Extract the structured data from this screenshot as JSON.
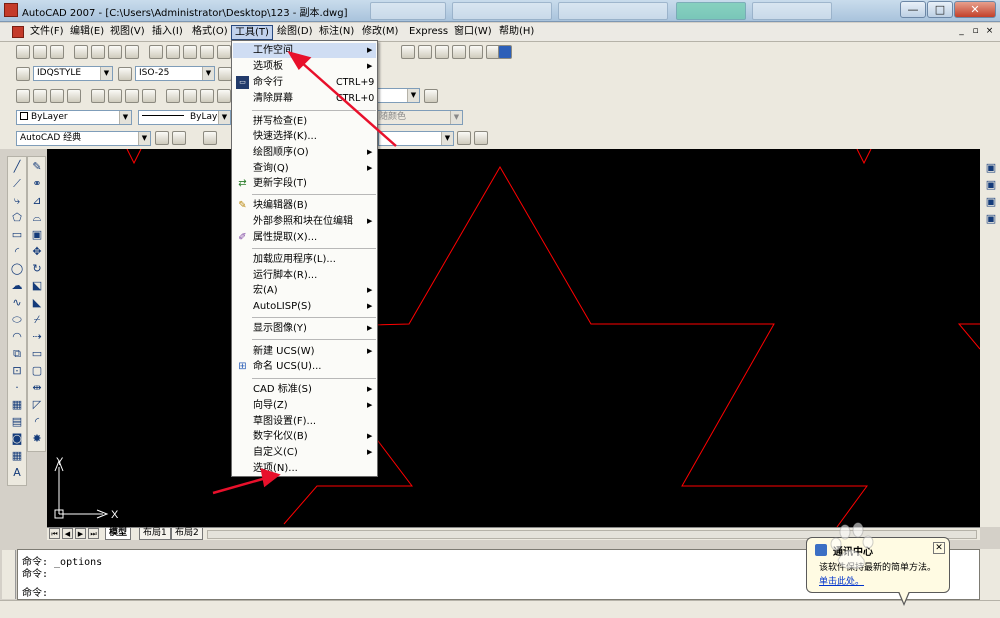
{
  "window": {
    "title": "AutoCAD 2007 - [C:\\Users\\Administrator\\Desktop\\123 - 副本.dwg]",
    "minimize": "—",
    "maximize": "□",
    "close": "✕",
    "mdi_controls": [
      "_",
      "▫",
      "×"
    ]
  },
  "menubar": {
    "items": [
      {
        "label": "文件(F)"
      },
      {
        "label": "编辑(E)"
      },
      {
        "label": "视图(V)"
      },
      {
        "label": "插入(I)"
      },
      {
        "label": "格式(O)"
      },
      {
        "label": "工具(T)"
      },
      {
        "label": "绘图(D)"
      },
      {
        "label": "标注(N)"
      },
      {
        "label": "修改(M)"
      },
      {
        "label": "Express"
      },
      {
        "label": "窗口(W)"
      },
      {
        "label": "帮助(H)"
      }
    ]
  },
  "toolbars": {
    "text_style": "IDQSTYLE",
    "dim_style": "ISO-25",
    "layer_color": "ByLayer",
    "linetype": "ByLayer",
    "workspace": "AutoCAD 经典",
    "plot_color": "随颜色"
  },
  "tools_menu": {
    "items": [
      {
        "label": "工作空间",
        "shortcut": "",
        "submenu": true,
        "icon": ""
      },
      {
        "label": "选项板",
        "shortcut": "",
        "submenu": true,
        "icon": ""
      },
      {
        "label": "命令行",
        "shortcut": "CTRL+9",
        "submenu": false,
        "icon": "command-line-icon"
      },
      {
        "label": "清除屏幕",
        "shortcut": "CTRL+0",
        "submenu": false,
        "icon": ""
      },
      {
        "label": "拼写检查(E)",
        "shortcut": "",
        "submenu": false,
        "icon": ""
      },
      {
        "label": "快速选择(K)...",
        "shortcut": "",
        "submenu": false,
        "icon": ""
      },
      {
        "label": "绘图顺序(O)",
        "shortcut": "",
        "submenu": true,
        "icon": ""
      },
      {
        "label": "查询(Q)",
        "shortcut": "",
        "submenu": true,
        "icon": ""
      },
      {
        "label": "更新字段(T)",
        "shortcut": "",
        "submenu": false,
        "icon": "update-field-icon"
      },
      {
        "label": "块编辑器(B)",
        "shortcut": "",
        "submenu": false,
        "icon": "block-editor-icon"
      },
      {
        "label": "外部参照和块在位编辑",
        "shortcut": "",
        "submenu": true,
        "icon": ""
      },
      {
        "label": "属性提取(X)...",
        "shortcut": "",
        "submenu": false,
        "icon": "attribute-extract-icon"
      },
      {
        "label": "加载应用程序(L)...",
        "shortcut": "",
        "submenu": false,
        "icon": ""
      },
      {
        "label": "运行脚本(R)...",
        "shortcut": "",
        "submenu": false,
        "icon": ""
      },
      {
        "label": "宏(A)",
        "shortcut": "",
        "submenu": true,
        "icon": ""
      },
      {
        "label": "AutoLISP(S)",
        "shortcut": "",
        "submenu": true,
        "icon": ""
      },
      {
        "label": "显示图像(Y)",
        "shortcut": "",
        "submenu": true,
        "icon": ""
      },
      {
        "label": "新建 UCS(W)",
        "shortcut": "",
        "submenu": true,
        "icon": ""
      },
      {
        "label": "命名 UCS(U)...",
        "shortcut": "",
        "submenu": false,
        "icon": "named-ucs-icon"
      },
      {
        "label": "CAD 标准(S)",
        "shortcut": "",
        "submenu": true,
        "icon": ""
      },
      {
        "label": "向导(Z)",
        "shortcut": "",
        "submenu": true,
        "icon": ""
      },
      {
        "label": "草图设置(F)...",
        "shortcut": "",
        "submenu": false,
        "icon": ""
      },
      {
        "label": "数字化仪(B)",
        "shortcut": "",
        "submenu": true,
        "icon": ""
      },
      {
        "label": "自定义(C)",
        "shortcut": "",
        "submenu": true,
        "icon": ""
      },
      {
        "label": "选项(N)...",
        "shortcut": "",
        "submenu": false,
        "icon": ""
      }
    ]
  },
  "layout_tabs": [
    "模型",
    "布局1",
    "布局2"
  ],
  "ucs": {
    "x_label": "X",
    "y_label": "Y"
  },
  "command_window": {
    "lines": [
      "命令: _options",
      "命令:",
      "命令:"
    ]
  },
  "balloon": {
    "title": "通讯中心",
    "message": "该软件保持最新的简单方法。",
    "link": "单击此处。"
  },
  "colors": {
    "drawing_bg": "#000000",
    "star_stroke": "#ff0000",
    "annotation_arrow": "#e8102b",
    "menu_highlight": "#cfddf3"
  }
}
